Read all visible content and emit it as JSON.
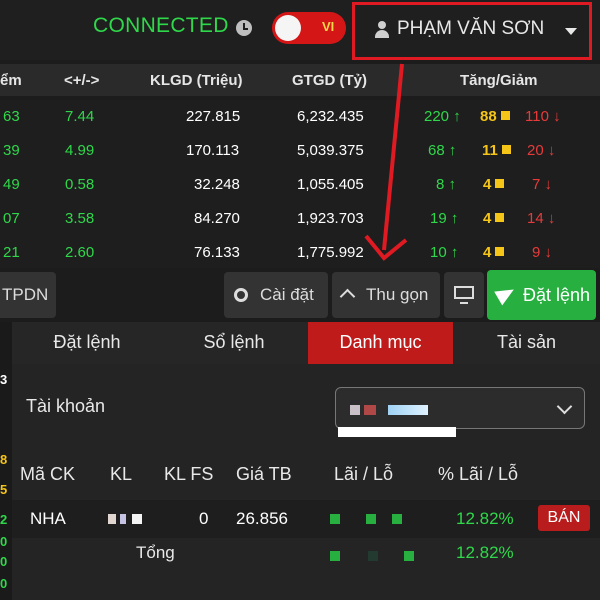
{
  "header": {
    "status": "CONNECTED",
    "language": "VI",
    "user_name": "PHẠM VĂN SƠN"
  },
  "market_table": {
    "columns": [
      "ểm",
      "<+/->",
      "KLGD (Triệu)",
      "GTGD (Tỷ)",
      "Tăng/Giảm"
    ],
    "rows": [
      {
        "point": "63",
        "change": "7.44",
        "klgd": "227.815",
        "gtgd": "6,232.435",
        "up": "220 ↑",
        "flat": "88",
        "down": "110 ↓"
      },
      {
        "point": "39",
        "change": "4.99",
        "klgd": "170.113",
        "gtgd": "5,039.375",
        "up": "68 ↑",
        "flat": "11",
        "down": "20 ↓"
      },
      {
        "point": "49",
        "change": "0.58",
        "klgd": "32.248",
        "gtgd": "1,055.405",
        "up": "8 ↑",
        "flat": "4",
        "down": "7 ↓"
      },
      {
        "point": "07",
        "change": "3.58",
        "klgd": "84.270",
        "gtgd": "1,923.703",
        "up": "19 ↑",
        "flat": "4",
        "down": "14 ↓"
      },
      {
        "point": "21",
        "change": "2.60",
        "klgd": "76.133",
        "gtgd": "1,775.992",
        "up": "10 ↑",
        "flat": "4",
        "down": "9 ↓"
      }
    ]
  },
  "toolbar": {
    "tpdn": "TPDN",
    "settings": "Cài đặt",
    "collapse": "Thu gọn",
    "place_order": "Đặt lệnh"
  },
  "panel": {
    "tabs": [
      "Đặt lệnh",
      "Sổ lệnh",
      "Danh mục",
      "Tài sản"
    ],
    "active_tab": "Danh mục",
    "account_label": "Tài khoản",
    "columns": [
      "Mã CK",
      "KL",
      "KL FS",
      "Giá TB",
      "Lãi / Lỗ",
      "% Lãi / Lỗ"
    ],
    "position": {
      "symbol": "NHA",
      "kl_fs": "0",
      "avg_price": "26.856",
      "pct": "12.82%",
      "action": "BÁN"
    },
    "total": {
      "label": "Tổng",
      "pct": "12.82%"
    }
  },
  "left_edge_digits": [
    "3",
    "8",
    "5",
    "2",
    "0",
    "0",
    "0"
  ],
  "colors": {
    "up": "#2fd84a",
    "flat": "#f5c518",
    "down": "#e83a3a",
    "accent_red": "#c01b1b",
    "order_green": "#27b040"
  }
}
